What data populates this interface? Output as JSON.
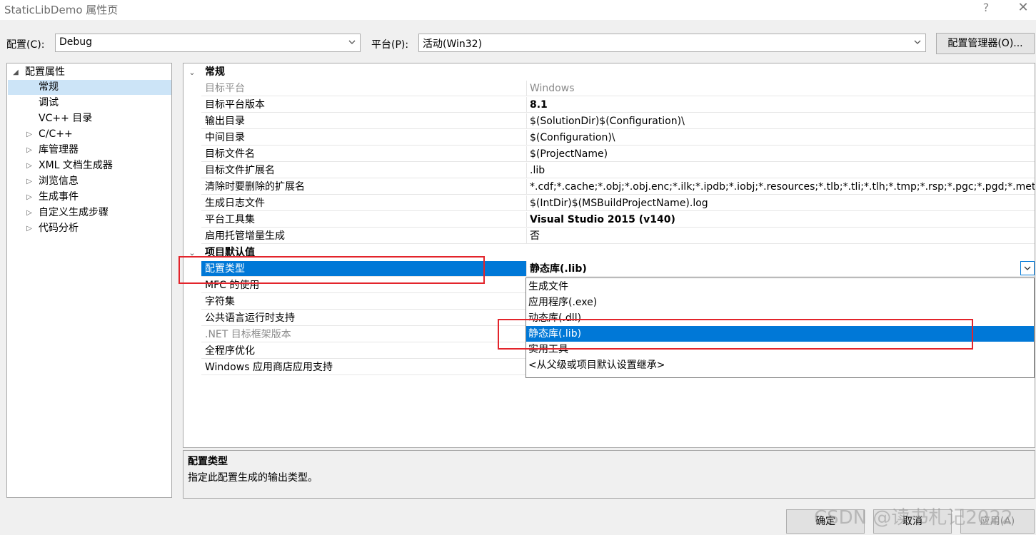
{
  "window": {
    "title": "StaticLibDemo 属性页",
    "help": "?",
    "close": "✕"
  },
  "config_row": {
    "config_label": "配置(C):",
    "config_value": "Debug",
    "platform_label": "平台(P):",
    "platform_value": "活动(Win32)",
    "manager_button": "配置管理器(O)..."
  },
  "tree": {
    "items": [
      {
        "label": "配置属性",
        "expander": "◢"
      },
      {
        "label": "常规",
        "selected": true
      },
      {
        "label": "调试"
      },
      {
        "label": "VC++ 目录"
      },
      {
        "label": "C/C++",
        "expander": "▷"
      },
      {
        "label": "库管理器",
        "expander": "▷"
      },
      {
        "label": "XML 文档生成器",
        "expander": "▷"
      },
      {
        "label": "浏览信息",
        "expander": "▷"
      },
      {
        "label": "生成事件",
        "expander": "▷"
      },
      {
        "label": "自定义生成步骤",
        "expander": "▷"
      },
      {
        "label": "代码分析",
        "expander": "▷"
      }
    ]
  },
  "grid": {
    "categories": [
      {
        "label": "常规",
        "chevron": "⌄"
      },
      {
        "label": "项目默认值",
        "chevron": "⌄"
      }
    ],
    "general_rows": [
      {
        "name": "目标平台",
        "value": "Windows"
      },
      {
        "name": "目标平台版本",
        "value": "8.1"
      },
      {
        "name": "输出目录",
        "value": "$(SolutionDir)$(Configuration)\\"
      },
      {
        "name": "中间目录",
        "value": "$(Configuration)\\"
      },
      {
        "name": "目标文件名",
        "value": "$(ProjectName)"
      },
      {
        "name": "目标文件扩展名",
        "value": ".lib"
      },
      {
        "name": "清除时要删除的扩展名",
        "value": "*.cdf;*.cache;*.obj;*.obj.enc;*.ilk;*.ipdb;*.iobj;*.resources;*.tlb;*.tli;*.tlh;*.tmp;*.rsp;*.pgc;*.pgd;*.meta;*.tlog;*.manifest"
      },
      {
        "name": "生成日志文件",
        "value": "$(IntDir)$(MSBuildProjectName).log"
      },
      {
        "name": "平台工具集",
        "value": "Visual Studio 2015 (v140)"
      },
      {
        "name": "启用托管增量生成",
        "value": "否"
      }
    ],
    "defaults_rows": [
      {
        "name": "配置类型",
        "value": "静态库(.lib)"
      },
      {
        "name": "MFC 的使用",
        "value": ""
      },
      {
        "name": "字符集",
        "value": ""
      },
      {
        "name": "公共语言运行时支持",
        "value": ""
      },
      {
        "name": ".NET 目标框架版本",
        "value": ""
      },
      {
        "name": "全程序优化",
        "value": ""
      },
      {
        "name": "Windows 应用商店应用支持",
        "value": ""
      }
    ]
  },
  "dropdown": {
    "options": [
      "生成文件",
      "应用程序(.exe)",
      "动态库(.dll)",
      "静态库(.lib)",
      "实用工具",
      "<从父级或项目默认设置继承>"
    ],
    "selected_index": 3
  },
  "description": {
    "title": "配置类型",
    "text": "指定此配置生成的输出类型。"
  },
  "buttons": {
    "ok": "确定",
    "cancel": "取消",
    "apply": "应用(A)"
  },
  "watermark": "CSDN @读书札记2022",
  "colors": {
    "selection": "#0078d7",
    "highlight_box": "#e3242b"
  }
}
